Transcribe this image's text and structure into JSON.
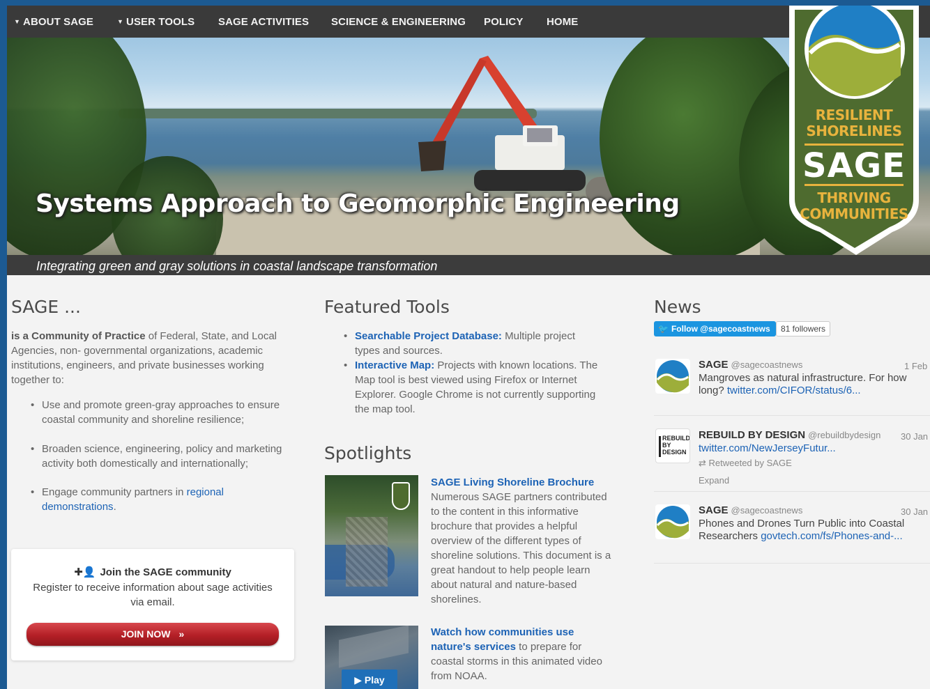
{
  "nav": {
    "items": [
      {
        "label": "About SAGE",
        "caret": true
      },
      {
        "label": "User Tools",
        "caret": true
      },
      {
        "label": "SAGE Activities",
        "caret": false
      },
      {
        "label": "Science & Engineering",
        "caret": false
      },
      {
        "label": "Policy",
        "caret": false
      },
      {
        "label": "Home",
        "caret": false
      }
    ]
  },
  "hero": {
    "title": "Systems Approach to Geomorphic Engineering",
    "subtitle": "Integrating green and gray solutions in coastal landscape transformation"
  },
  "badge": {
    "top_line1": "RESILIENT",
    "top_line2": "SHORELINES",
    "name": "SAGE",
    "bottom_line1": "THRIVING",
    "bottom_line2": "COMMUNITIES"
  },
  "about": {
    "heading": "SAGE ...",
    "intro_bold": "is a Community of Practice",
    "intro_rest": " of Federal, State, and Local Agencies, non- governmental organizations, academic institutions, engineers, and private businesses working together to:",
    "bullets": [
      "Use and promote green-gray approaches to ensure coastal community and shoreline resilience;",
      "Broaden science, engineering, policy and marketing activity both domestically and internationally;"
    ],
    "bullet3_text": "Engage community partners in ",
    "bullet3_link": "regional demonstrations",
    "bullet3_end": "."
  },
  "join": {
    "title": "Join the SAGE community",
    "description": "Register to receive information about sage activities via email.",
    "button": "JOIN NOW"
  },
  "tools": {
    "heading": "Featured Tools",
    "items": [
      {
        "link": "Searchable Project Database:",
        "text": " Multiple project types and sources."
      },
      {
        "link": "Interactive Map:",
        "text": " Projects with known locations. The Map tool is best viewed using Firefox or Internet Explorer. Google Chrome is not currently supporting the map tool."
      }
    ]
  },
  "spotlights": {
    "heading": "Spotlights",
    "items": [
      {
        "link": "SAGE Living Shoreline Brochure",
        "text": "Numerous SAGE partners contributed to the content in this informative brochure that provides a helpful overview of the different types of shoreline solutions. This document is a great handout to help people learn about natural and nature-based shorelines."
      },
      {
        "link": "Watch how communities use nature's services",
        "text": " to prepare for coastal storms in this animated video from NOAA.",
        "play_label": "Play"
      }
    ]
  },
  "news": {
    "heading": "News",
    "follow_label": "Follow @sagecoastnews",
    "followers": "81 followers",
    "tweets": [
      {
        "name": "SAGE",
        "handle": "@sagecoastnews",
        "date": "1 Feb",
        "text": "Mangroves as natural infrastructure. For how long? ",
        "link": "twitter.com/CIFOR/status/6..."
      },
      {
        "name": "REBUILD BY DESIGN",
        "handle": "@rebuildbydesign",
        "date": "30 Jan",
        "link": "twitter.com/NewJerseyFutur...",
        "retweet": "Retweeted by SAGE",
        "expand": "Expand",
        "avatar_text": "REBUILD BY DESIGN"
      },
      {
        "name": "SAGE",
        "handle": "@sagecoastnews",
        "date": "30 Jan",
        "text": "Phones and Drones Turn Public into Coastal Researchers ",
        "link": "govtech.com/fs/Phones-and-..."
      }
    ]
  },
  "colors": {
    "nav_bg": "#3a3a3a",
    "link": "#1d63b5",
    "badge_green": "#4e6b2f",
    "badge_gold": "#e8b33d",
    "button_red": "#b41f26",
    "twitter_blue": "#1b95e0"
  }
}
